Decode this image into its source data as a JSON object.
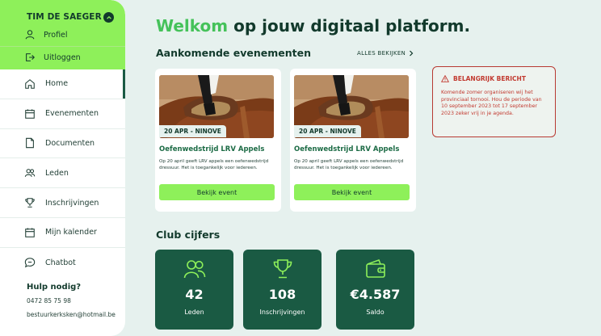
{
  "sidebar": {
    "user_name": "TIM DE SAEGER",
    "profile_label": "Profiel",
    "logout_label": "Uitloggen",
    "items": [
      {
        "label": "Home",
        "icon": "home-icon",
        "active": true
      },
      {
        "label": "Evenementen",
        "icon": "calendar-icon"
      },
      {
        "label": "Documenten",
        "icon": "document-icon"
      },
      {
        "label": "Leden",
        "icon": "users-icon"
      },
      {
        "label": "Inschrijvingen",
        "icon": "trophy-icon"
      },
      {
        "label": "Mijn kalender",
        "icon": "calendar-icon"
      },
      {
        "label": "Chatbot",
        "icon": "chat-icon"
      }
    ],
    "help": {
      "title": "Hulp nodig?",
      "phone": "0472 85 75 98",
      "email": "bestuurkerksken@hotmail.be"
    }
  },
  "header": {
    "welcome_accent": "Welkom",
    "welcome_rest": " op jouw digitaal platform."
  },
  "events": {
    "title": "Aankomende evenementen",
    "see_all": "ALLES BEKIJKEN",
    "items": [
      {
        "date": "20 APR - NINOVE",
        "title": "Oefenwedstrijd LRV Appels",
        "description": "Op 20 april geeft LRV appels een oefenwedstrijd dressuur. Het is toegankelijk voor iedereen.",
        "button": "Bekijk event"
      },
      {
        "date": "20 APR - NINOVE",
        "title": "Oefenwedstrijd LRV Appels",
        "description": "Op 20 april geeft LRV appels een oefenwedstrijd dressuur. Het is toegankelijk voor iedereen.",
        "button": "Bekijk event"
      }
    ]
  },
  "notice": {
    "title": "BELANGRIJK BERICHT",
    "text": "Komende zomer organiseren wij het provinciaal tornooi. Hou de periode van 10 september 2023 tot 17 september 2023 zeker vrij in je agenda."
  },
  "stats": {
    "title": "Club cijfers",
    "items": [
      {
        "value": "42",
        "label": "Leden",
        "icon": "users-icon"
      },
      {
        "value": "108",
        "label": "Inschrijvingen",
        "icon": "trophy-icon"
      },
      {
        "value": "€4.587",
        "label": "Saldo",
        "icon": "wallet-icon"
      }
    ]
  },
  "colors": {
    "accent_green": "#8ef05a",
    "dark_green": "#1a5a43",
    "background": "#e6f1ee",
    "alert_red": "#c23a30"
  }
}
